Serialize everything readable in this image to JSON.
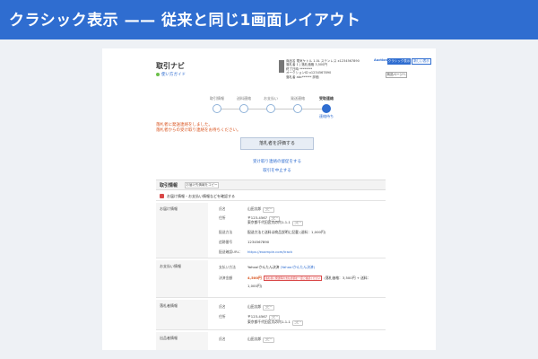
{
  "banner": {
    "title": "クラシック表示 —— 従来と同じ1画面レイアウト"
  },
  "header": {
    "title": "取引ナビ",
    "guide": "使い方ガイド",
    "product_lines": [
      "商品名 電気ケトル 1.0L ステンレス x1234567890",
      "落札者 1 | 落札価格 3,500円",
      "終了日時 ********",
      "オークションID x1234567890",
      "落札者 abc****** 評価"
    ],
    "account": "Auctions",
    "classic_button": "クラシック表示",
    "new_button": "新しい表示",
    "detail_button": "商品ページへ"
  },
  "steps": {
    "labels": [
      "取引情報",
      "送料連絡",
      "お支払い",
      "発送連絡",
      "受取連絡"
    ],
    "active_index": 4,
    "status": "連絡待ち"
  },
  "notice": {
    "line1": "落札者に発送連絡をしました。",
    "line2": "落札者からの受け取り連絡をお待ちください。"
  },
  "actions": {
    "rate_button": "落札者を評価する",
    "link1": "受け取り連絡の督促をする",
    "link2": "取引を中止する"
  },
  "transaction": {
    "title": "取引情報",
    "shipment_button": "お届け先情報をコピー",
    "confirm_text": "お届け情報・お支払い情報などを確認する"
  },
  "delivery": {
    "title": "お届け情報",
    "name_label": "氏名",
    "name_value": "山田太郎",
    "address_label": "住所",
    "address_value1": "〒123-4567",
    "address_value2": "東京都千代田区丸の内1-1-1",
    "method_label": "配送方法",
    "method_value": "配送方法と送料は商品説明に記載 (送料：1,000円)",
    "tracking_label": "追跡番号",
    "tracking_value": "1234567890",
    "url_label": "配送確認URL：",
    "url_value": "https://example.com/track",
    "copy_pill": "コピー"
  },
  "payment": {
    "title": "お支払い情報",
    "method_label": "支払い方法",
    "method_value": "Yahoo!かんたん決済",
    "method_link": "(Yahoo!かんたん決済)",
    "amount_label": "決済金額",
    "amount_value": "4,500円",
    "amount_note": "落札者に発送時の支払金額を一度ご確認ください",
    "amount_detail": "(落札価格：3,500円 + 送料：",
    "amount_detail2": "1,000円)"
  },
  "winner": {
    "title": "落札者情報",
    "name_label": "氏名",
    "name_value": "山田太郎",
    "address_label": "住所",
    "address_value1": "〒123-4567",
    "address_value2": "東京都千代田区丸の内1-1-1",
    "copy_pill": "コピー"
  },
  "seller": {
    "title": "出品者情報",
    "name_label": "氏名",
    "name_value": "山田太郎",
    "copy_pill": "コピー"
  },
  "colors": {
    "accent": "#2f6dd0",
    "warning": "#d9531e",
    "banner": "#2f6dd0"
  }
}
